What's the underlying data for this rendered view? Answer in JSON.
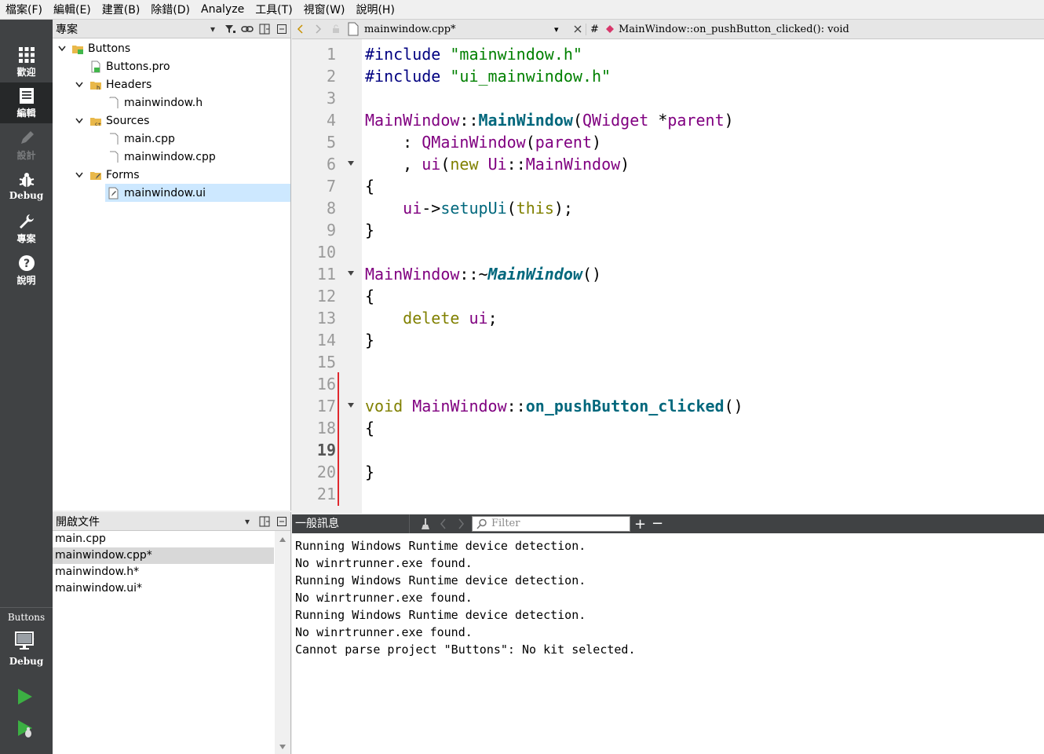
{
  "menu": [
    "檔案(F)",
    "編輯(E)",
    "建置(B)",
    "除錯(D)",
    "Analyze",
    "工具(T)",
    "視窗(W)",
    "說明(H)"
  ],
  "modes": [
    {
      "label": "歡迎",
      "icon": "welcome-grid-icon"
    },
    {
      "label": "編輯",
      "icon": "edit-document-icon"
    },
    {
      "label": "設計",
      "icon": "design-pencil-icon"
    },
    {
      "label": "Debug",
      "icon": "debug-bug-icon"
    },
    {
      "label": "專案",
      "icon": "project-wrench-icon"
    },
    {
      "label": "說明",
      "icon": "help-question-icon"
    }
  ],
  "kit": {
    "project": "Buttons",
    "config": "Debug"
  },
  "project_panel": {
    "title": "專案",
    "tree": [
      {
        "label": "Buttons",
        "level": 0,
        "kind": "project",
        "expanded": true
      },
      {
        "label": "Buttons.pro",
        "level": 1,
        "kind": "pro-file"
      },
      {
        "label": "Headers",
        "level": 1,
        "kind": "folder",
        "expanded": true
      },
      {
        "label": "mainwindow.h",
        "level": 2,
        "kind": "file"
      },
      {
        "label": "Sources",
        "level": 1,
        "kind": "folder",
        "expanded": true
      },
      {
        "label": "main.cpp",
        "level": 2,
        "kind": "file"
      },
      {
        "label": "mainwindow.cpp",
        "level": 2,
        "kind": "file"
      },
      {
        "label": "Forms",
        "level": 1,
        "kind": "folder",
        "expanded": true
      },
      {
        "label": "mainwindow.ui",
        "level": 2,
        "kind": "ui-file",
        "selected": true
      }
    ]
  },
  "open_docs": {
    "title": "開啟文件",
    "items": [
      "main.cpp",
      "mainwindow.cpp*",
      "mainwindow.h*",
      "mainwindow.ui*"
    ],
    "selected": "mainwindow.cpp*"
  },
  "editor": {
    "file": "mainwindow.cpp*",
    "hash": "#",
    "symbol": "MainWindow::on_pushButton_clicked(): void",
    "current_line": "19",
    "line_numbers": [
      "1",
      "2",
      "3",
      "4",
      "5",
      "6",
      "7",
      "8",
      "9",
      "10",
      "11",
      "12",
      "13",
      "14",
      "15",
      "16",
      "17",
      "18",
      "19",
      "20",
      "21"
    ]
  },
  "output": {
    "title": "一般訊息",
    "filter_placeholder": "Filter",
    "lines": [
      "Running Windows Runtime device detection.",
      "No winrtrunner.exe found.",
      "Running Windows Runtime device detection.",
      "No winrtrunner.exe found.",
      "Running Windows Runtime device detection.",
      "No winrtrunner.exe found.",
      "Cannot parse project \"Buttons\": No kit selected."
    ]
  },
  "colors": {
    "accent": "#cde8ff",
    "modebar": "#404244",
    "change_marker": "#e0282e",
    "run_green": "#3cb043"
  }
}
